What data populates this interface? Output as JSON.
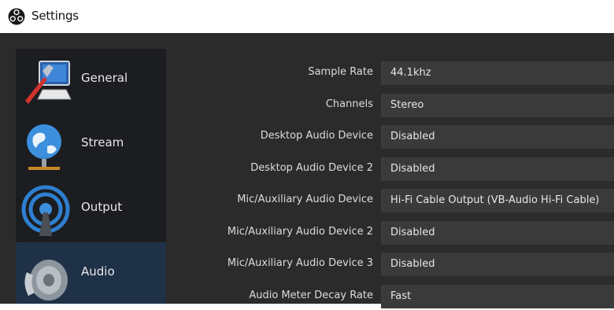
{
  "window": {
    "title": "Settings",
    "icon": "obs-logo-icon"
  },
  "sidebar": {
    "items": [
      {
        "label": "General",
        "icon": "general-settings-icon",
        "selected": false
      },
      {
        "label": "Stream",
        "icon": "stream-globe-icon",
        "selected": false
      },
      {
        "label": "Output",
        "icon": "output-antenna-icon",
        "selected": false
      },
      {
        "label": "Audio",
        "icon": "audio-speaker-icon",
        "selected": true
      }
    ]
  },
  "audio": {
    "rows": [
      {
        "label": "Sample Rate",
        "value": "44.1khz"
      },
      {
        "label": "Channels",
        "value": "Stereo"
      },
      {
        "label": "Desktop Audio Device",
        "value": "Disabled"
      },
      {
        "label": "Desktop Audio Device 2",
        "value": "Disabled"
      },
      {
        "label": "Mic/Auxiliary Audio Device",
        "value": "Hi-Fi Cable Output (VB-Audio Hi-Fi Cable)"
      },
      {
        "label": "Mic/Auxiliary Audio Device 2",
        "value": "Disabled"
      },
      {
        "label": "Mic/Auxiliary Audio Device 3",
        "value": "Disabled"
      },
      {
        "label": "Audio Meter Decay Rate",
        "value": "Fast"
      }
    ]
  },
  "colors": {
    "background": "#2b2b2b",
    "sidebar": "#1b1d20",
    "selected": "#1f3147",
    "field": "#3a3a3a",
    "text": "#dcdcdc"
  }
}
